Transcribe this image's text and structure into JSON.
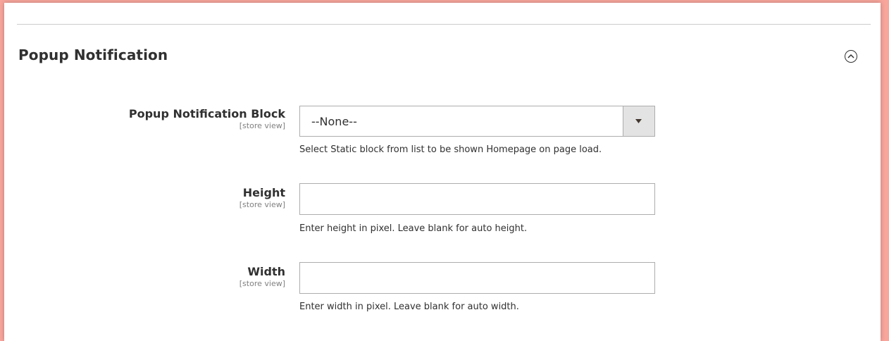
{
  "section": {
    "title": "Popup Notification",
    "toggle_icon": "chevron-up-circle-icon"
  },
  "fields": {
    "block": {
      "label": "Popup Notification Block",
      "scope": "[store view]",
      "selected": "--None--",
      "note": "Select Static block from list to be shown Homepage on page load."
    },
    "height": {
      "label": "Height",
      "scope": "[store view]",
      "value": "",
      "note": "Enter height in pixel. Leave blank for auto height."
    },
    "width": {
      "label": "Width",
      "scope": "[store view]",
      "value": "",
      "note": "Enter width in pixel. Leave blank for auto width."
    }
  },
  "colors": {
    "background_frame": "#f8a59c",
    "panel": "#ffffff",
    "text": "#303030",
    "border": "#adadad"
  }
}
